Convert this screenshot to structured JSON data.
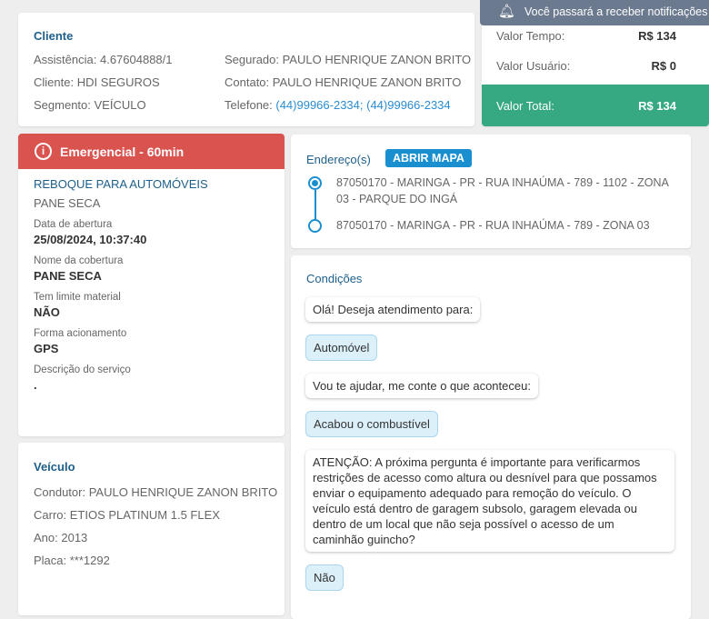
{
  "notification": {
    "text": "Você passará a receber notificações cas",
    "icon": "bell-icon"
  },
  "cliente": {
    "title": "Cliente",
    "assistencia": "Assistência: 4.67604888/1",
    "cliente": "Cliente: HDI SEGUROS",
    "segmento": "Segmento: VEÍCULO",
    "segurado": "Segurado: PAULO HENRIQUE ZANON BRITO",
    "contato": "Contato: PAULO HENRIQUE ZANON BRITO",
    "telefone_label": "Telefone: ",
    "telefone": "(44)99966-2334; (44)99966-2334"
  },
  "valores": {
    "tempo_label": "Valor Tempo:",
    "tempo": "R$ 134",
    "usuario_label": "Valor Usuário:",
    "usuario": "R$ 0",
    "total_label": "Valor Total:",
    "total": "R$ 134",
    "total_color": "#36a982"
  },
  "servico": {
    "badge": "Emergencial - 60min",
    "badge_color": "#d9534f",
    "name": "REBOQUE PARA AUTOMÓVEIS",
    "subtitle": "PANE SECA",
    "fields": [
      {
        "label": "Data de abertura",
        "value": "25/08/2024, 10:37:40"
      },
      {
        "label": "Nome da cobertura",
        "value": "PANE SECA"
      },
      {
        "label": "Tem limite material",
        "value": "NÃO"
      },
      {
        "label": "Forma acionamento",
        "value": "GPS"
      },
      {
        "label": "Descrição do serviço",
        "value": "."
      }
    ]
  },
  "veiculo": {
    "title": "Veículo",
    "condutor": "Condutor: PAULO HENRIQUE ZANON BRITO",
    "carro": "Carro: ETIOS PLATINUM 1.5 FLEX",
    "ano": "Ano: 2013",
    "placa": "Placa: ***1292"
  },
  "endereco": {
    "title": "Endereço(s)",
    "button": "ABRIR MAPA",
    "origem": "87050170 - MARINGA - PR - RUA INHAÚMA - 789 - 1102 - ZONA 03 - PARQUE DO INGÁ",
    "destino": "87050170 - MARINGA - PR - RUA INHAÚMA - 789 - ZONA 03"
  },
  "condicoes": {
    "title": "Condições",
    "messages": [
      {
        "from": "bot",
        "text": "Olá! Deseja atendimento para:"
      },
      {
        "from": "user",
        "text": "Automóvel"
      },
      {
        "from": "bot",
        "text": "Vou te ajudar, me conte o que aconteceu:"
      },
      {
        "from": "user",
        "text": "Acabou o combustível"
      },
      {
        "from": "bot",
        "text": "ATENÇÃO: A próxima pergunta é importante para verificarmos restrições de acesso como altura ou desnível para que possamos enviar o equipamento adequado para remoção do veículo. O veículo está dentro de garagem subsolo, garagem elevada ou dentro de um local que não seja possível o acesso de um caminhão guincho?"
      },
      {
        "from": "user",
        "text": "Não"
      }
    ]
  }
}
